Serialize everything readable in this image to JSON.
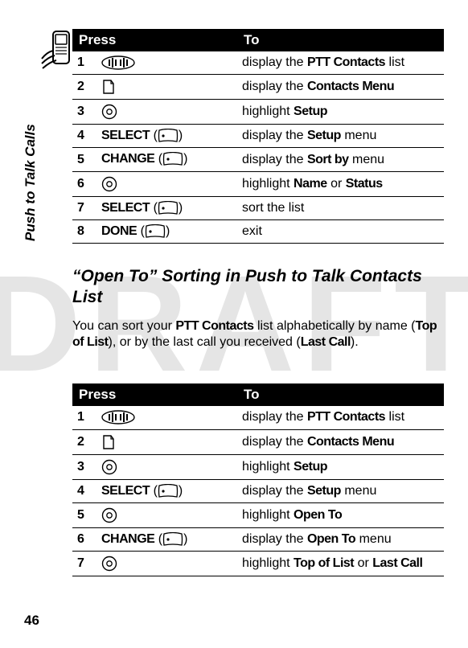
{
  "watermark": "DRAFT",
  "side_label": "Push to Talk Calls",
  "page_number": "46",
  "table_headers": {
    "press": "Press",
    "to": "To"
  },
  "table1": [
    {
      "n": "1",
      "to_pre": "display the ",
      "to_ui": "PTT Contacts",
      "to_post": " list"
    },
    {
      "n": "2",
      "to_pre": "display the ",
      "to_ui": "Contacts Menu",
      "to_post": ""
    },
    {
      "n": "3",
      "to_pre": "highlight ",
      "to_ui": "Setup",
      "to_post": ""
    },
    {
      "n": "4",
      "label": "SELECT",
      "to_pre": "display the ",
      "to_ui": "Setup",
      "to_post": " menu"
    },
    {
      "n": "5",
      "label": "CHANGE",
      "to_pre": "display the ",
      "to_ui": "Sort by",
      "to_post": " menu"
    },
    {
      "n": "6",
      "to_pre": "highlight ",
      "to_ui": "Name",
      "to_mid": " or ",
      "to_ui2": "Status",
      "to_post": ""
    },
    {
      "n": "7",
      "label": "SELECT",
      "to_pre": "sort the list",
      "to_ui": "",
      "to_post": ""
    },
    {
      "n": "8",
      "label": "DONE",
      "to_pre": "exit",
      "to_ui": "",
      "to_post": ""
    }
  ],
  "section_heading": "“Open To” Sorting in Push to Talk Contacts List",
  "body_pre": "You can sort your ",
  "body_ui1": "PTT Contacts",
  "body_mid1": " list alphabetically by name (",
  "body_ui2": "Top of List",
  "body_mid2": "), or by the last call you received (",
  "body_ui3": "Last Call",
  "body_post": ").",
  "table2": [
    {
      "n": "1",
      "to_pre": "display the ",
      "to_ui": "PTT Contacts",
      "to_post": " list"
    },
    {
      "n": "2",
      "to_pre": "display the ",
      "to_ui": "Contacts Menu",
      "to_post": ""
    },
    {
      "n": "3",
      "to_pre": "highlight ",
      "to_ui": "Setup",
      "to_post": ""
    },
    {
      "n": "4",
      "label": "SELECT",
      "to_pre": "display the ",
      "to_ui": "Setup",
      "to_post": " menu"
    },
    {
      "n": "5",
      "to_pre": "highlight ",
      "to_ui": "Open To",
      "to_post": ""
    },
    {
      "n": "6",
      "label": "CHANGE",
      "to_pre": "display the ",
      "to_ui": "Open To",
      "to_post": " menu"
    },
    {
      "n": "7",
      "to_pre": "highlight ",
      "to_ui": "Top of List",
      "to_mid": " or ",
      "to_ui2": "Last Call",
      "to_post": ""
    }
  ]
}
